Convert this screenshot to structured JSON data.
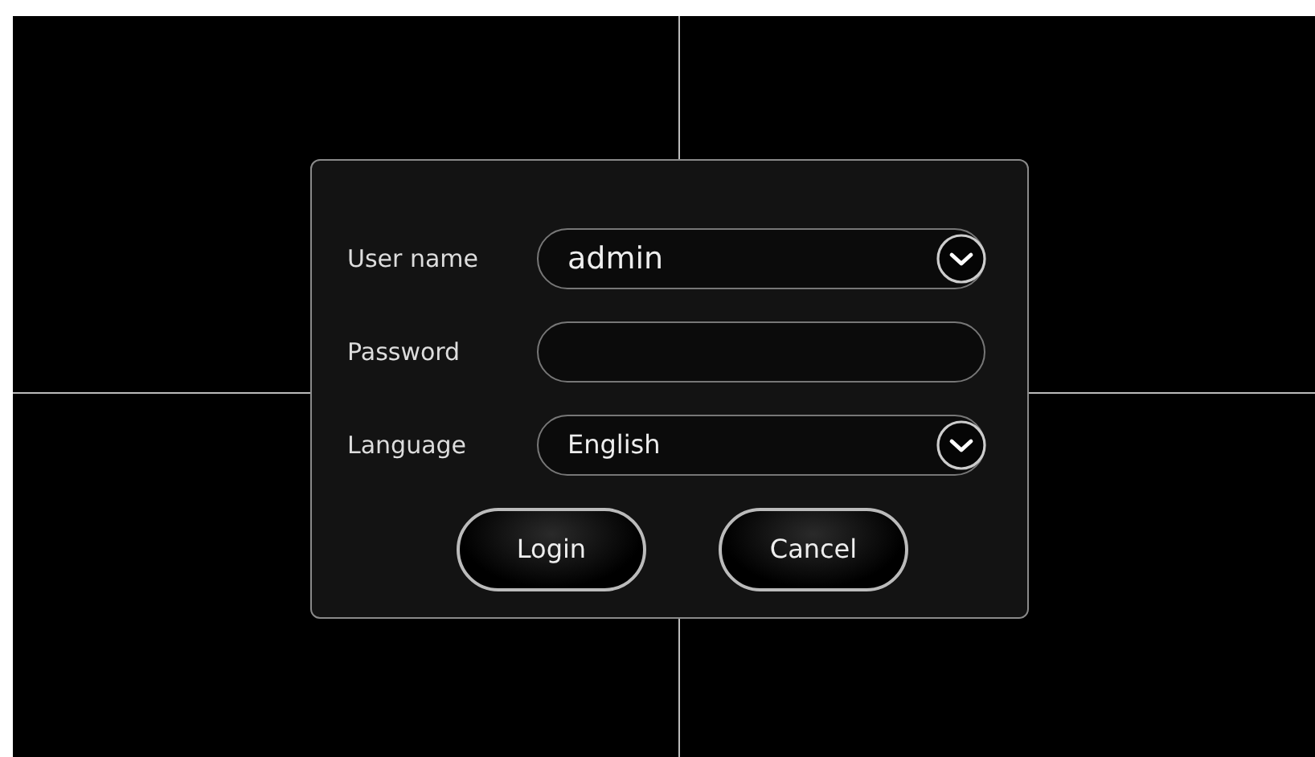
{
  "login_dialog": {
    "fields": [
      {
        "kind": "dropdown",
        "label": "User name",
        "value": "admin"
      },
      {
        "kind": "password",
        "label": "Password"
      },
      {
        "kind": "dropdown",
        "label": "Language",
        "value": "English"
      }
    ],
    "buttons": [
      "Login",
      "Cancel"
    ]
  }
}
